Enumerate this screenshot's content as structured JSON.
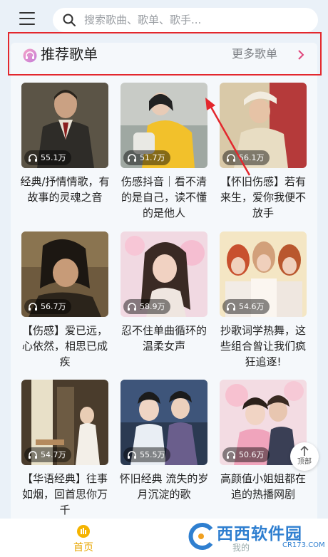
{
  "search": {
    "placeholder": "搜索歌曲、歌单、歌手..."
  },
  "section": {
    "title": "推荐歌单",
    "more_label": "更多歌单"
  },
  "playlists": [
    {
      "title": "经典/抒情情歌，有故事的灵魂之音",
      "plays": "55.1万"
    },
    {
      "title": "伤感抖音｜看不清的是自己，读不懂的是他人",
      "plays": "51.7万"
    },
    {
      "title": "【怀旧伤感】若有来生，爱你我便不放手",
      "plays": "56.1万"
    },
    {
      "title": "【伤感】爱已远，心依然，相思已成疾",
      "plays": "56.7万"
    },
    {
      "title": "忍不住单曲循环的温柔女声",
      "plays": "58.9万"
    },
    {
      "title": "抄歌词学热舞，这些组合曾让我们疯狂追逐!",
      "plays": "54.6万"
    },
    {
      "title": "【华语经典】往事如烟，回首思你万千",
      "plays": "54.7万"
    },
    {
      "title": "怀旧经典 流失的岁月沉淀的歌",
      "plays": "55.5万"
    },
    {
      "title": "高颜值小姐姐都在追的热播网剧",
      "plays": "50.6万"
    }
  ],
  "to_top": {
    "label": "顶部"
  },
  "bottom_nav": {
    "home_label": "首页",
    "tab2_label": "我的"
  },
  "watermark": {
    "text": "西西软件园",
    "url": "CR173.COM"
  },
  "colors": {
    "highlight_border": "#e3272d",
    "accent": "#e8a600",
    "chevron": "#e0457b",
    "watermark": "#2f7fd0"
  }
}
